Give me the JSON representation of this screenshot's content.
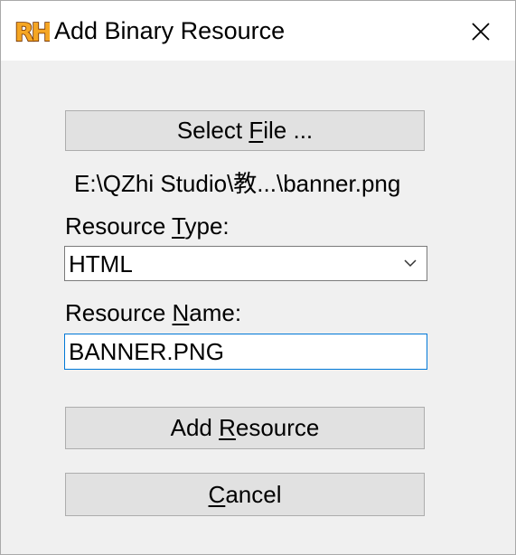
{
  "window": {
    "title": "Add Binary Resource",
    "icon": "rh-app-icon",
    "icon_text": "RH",
    "close_glyph": "✕"
  },
  "select_file": {
    "label_pre": "Select ",
    "label_mnemonic": "F",
    "label_post": "ile ..."
  },
  "file_path": "E:\\QZhi Studio\\教...\\banner.png",
  "resource_type": {
    "label_pre": "Resource ",
    "label_mnemonic": "T",
    "label_post": "ype:",
    "selected": "HTML",
    "icon": "chevron-down-icon"
  },
  "resource_name": {
    "label_pre": "Resource ",
    "label_mnemonic": "N",
    "label_post": "ame:",
    "value": "BANNER.PNG"
  },
  "add_resource": {
    "label_pre": "Add ",
    "label_mnemonic": "R",
    "label_post": "esource"
  },
  "cancel": {
    "label_pre": "",
    "label_mnemonic": "C",
    "label_post": "ancel"
  },
  "colors": {
    "titlebar": "#ffffff",
    "client": "#f0f0f0",
    "button_face": "#e1e1e1",
    "button_border": "#adadad",
    "focus_border": "#0078d7",
    "icon_fill": "#f5a623",
    "icon_stroke": "#6b2c00"
  }
}
